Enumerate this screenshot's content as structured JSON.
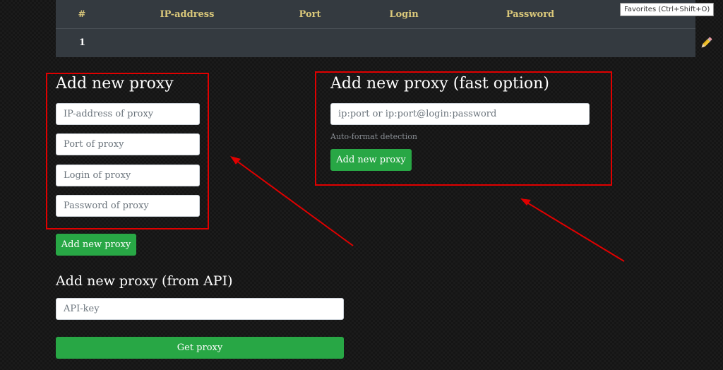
{
  "table": {
    "headers": [
      "#",
      "IP-address",
      "Port",
      "Login",
      "Password"
    ],
    "rows": [
      {
        "index": "1",
        "ip": "",
        "port": "",
        "login": "",
        "password": ""
      }
    ],
    "edit_icon": "pencil-icon"
  },
  "tooltip": "Favorites (Ctrl+Shift+O)",
  "manual_form": {
    "title": "Add new proxy",
    "ip_placeholder": "IP-address of proxy",
    "port_placeholder": "Port of proxy",
    "login_placeholder": "Login of proxy",
    "password_placeholder": "Password of proxy",
    "submit_label": "Add new proxy"
  },
  "fast_form": {
    "title": "Add new proxy (fast option)",
    "input_placeholder": "ip:port or ip:port@login:password",
    "hint": "Auto-format detection",
    "submit_label": "Add new proxy"
  },
  "api_form": {
    "title": "Add new proxy (from API)",
    "key_placeholder": "API-key",
    "submit_label": "Get proxy"
  },
  "colors": {
    "background": "#151515",
    "table_bg": "#343a40",
    "header_text": "#d9c77a",
    "button_green": "#28a745",
    "annotation_red": "#e00000"
  }
}
